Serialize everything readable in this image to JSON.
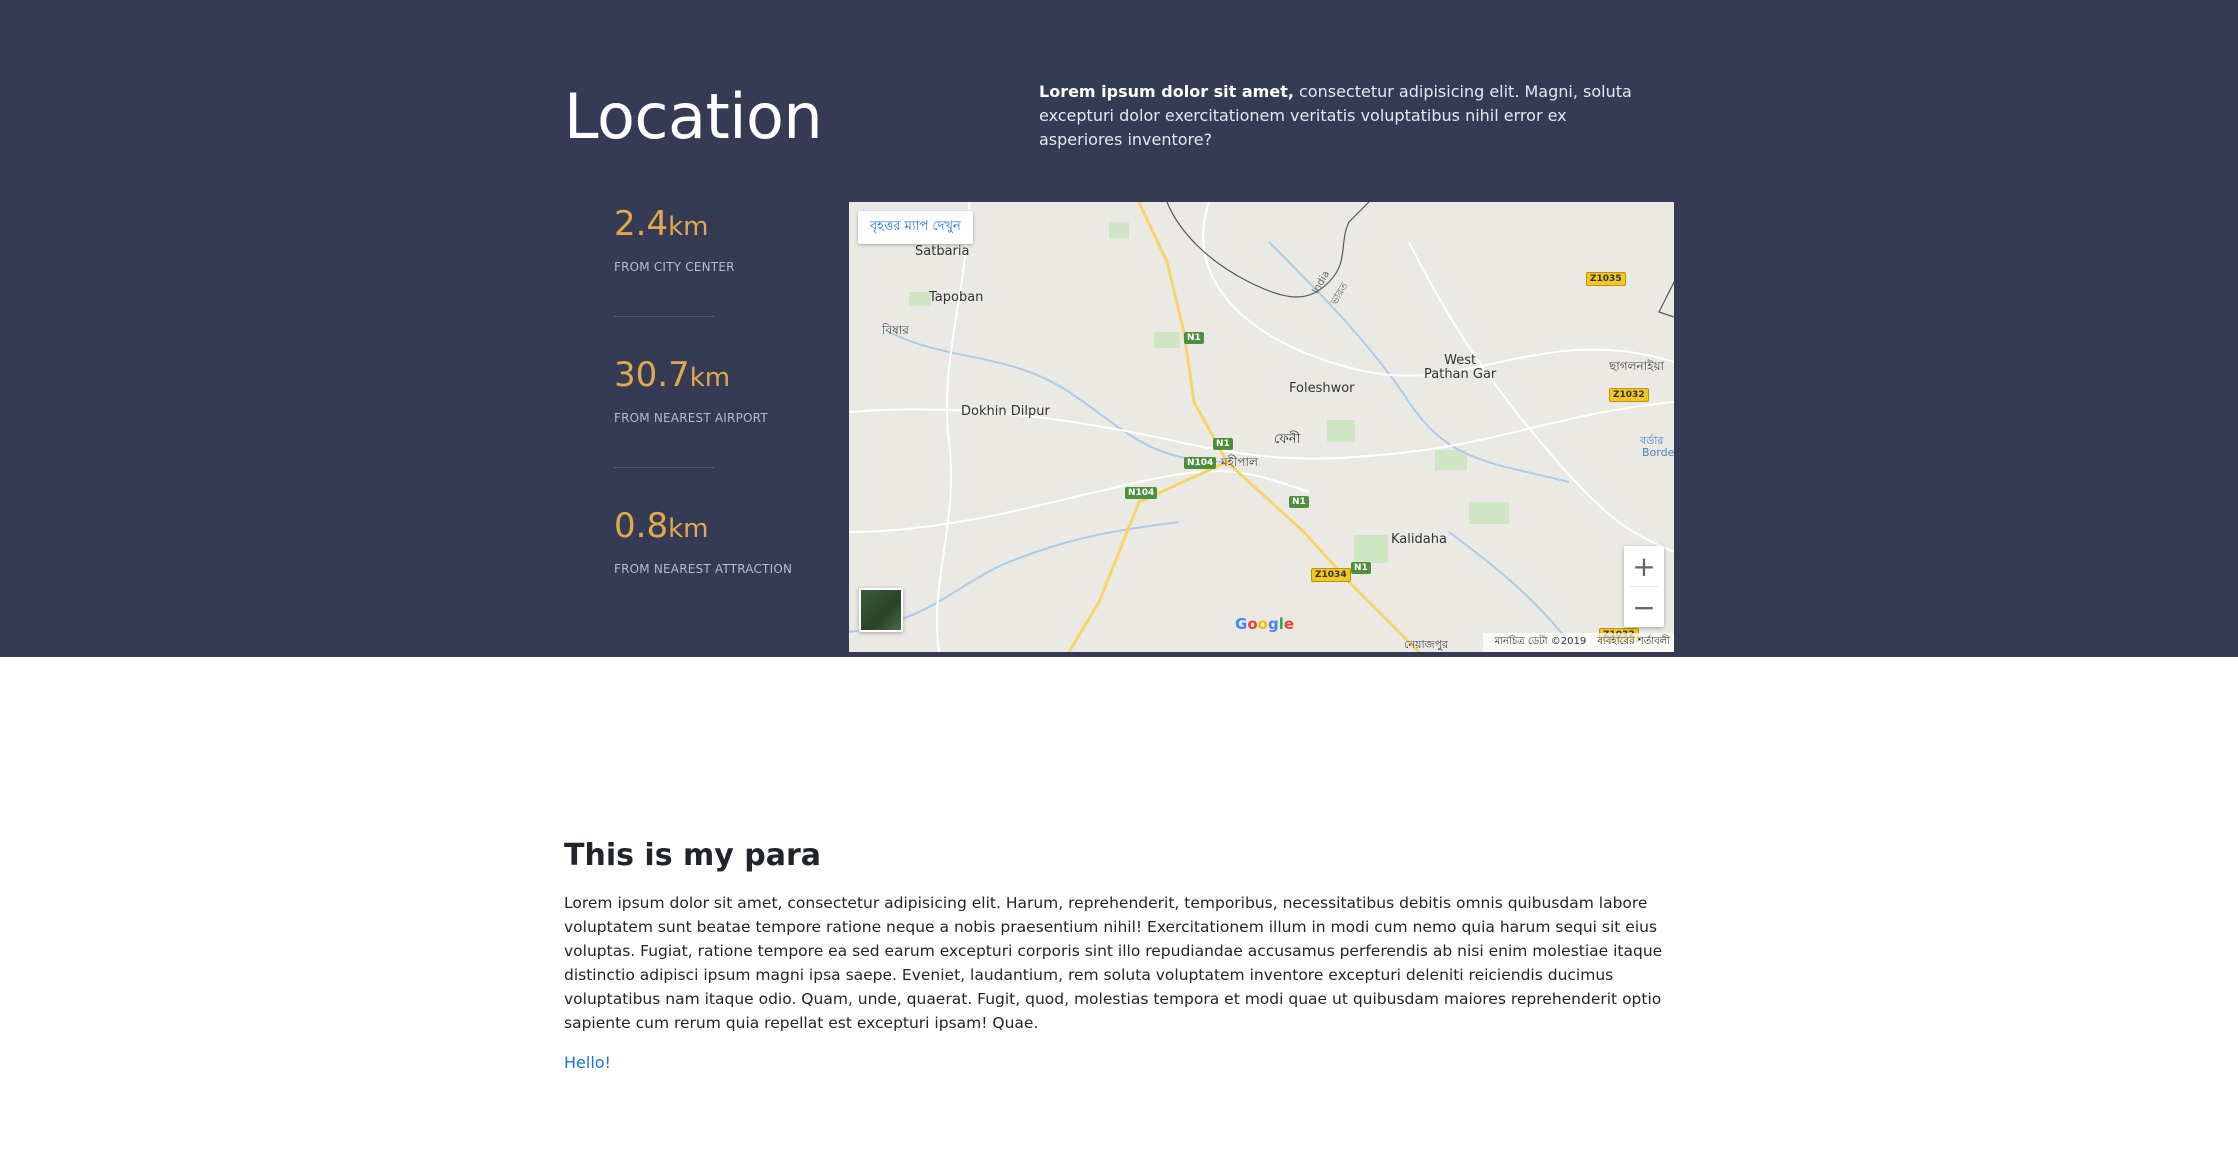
{
  "location": {
    "title": "Location",
    "intro_bold": "Lorem ipsum dolor sit amet,",
    "intro_text": " consectetur adipisicing elit. Magni, soluta excepturi dolor exercitationem veritatis voluptatibus nihil error ex asperiores inventore?"
  },
  "stats": [
    {
      "value": "2.4",
      "unit": "km",
      "label": "From city center"
    },
    {
      "value": "30.7",
      "unit": "km",
      "label": "From nearest airport"
    },
    {
      "value": "0.8",
      "unit": "km",
      "label": "From nearest attraction"
    }
  ],
  "map": {
    "view_larger_label": "বৃহত্তর ম্যাপ দেখুন",
    "places": {
      "satbaria": "Satbaria",
      "tapoban": "Tapoban",
      "bikhar": "বিষার",
      "dokhin_dilpur": "Dokhin Dilpur",
      "foleshwor": "Foleshwor",
      "west_pathan_gar": "West\nPathan Gar",
      "feni": "ফেনী",
      "mohipal": "মহীপাল",
      "kalidaha": "Kalidaha",
      "chagalnaiya": "ছাগলনাইয়া",
      "border_bn": "বর্ডার",
      "border_en": "Border",
      "india": "India",
      "bharat": "ভারত",
      "noyajpur": "নেয়াজপুর"
    },
    "roads": {
      "n1": "N1",
      "n104": "N104",
      "z1035": "Z1035",
      "z1032": "Z1032",
      "z1034": "Z1034"
    },
    "zoom_in": "+",
    "zoom_out": "−",
    "google": "Google",
    "map_data": "মানচিত্র ডেটা ©2019",
    "terms": "ব্যবহারের শর্তাবলী"
  },
  "paragraph": {
    "title": "This is my para",
    "body": "Lorem ipsum dolor sit amet, consectetur adipisicing elit. Harum, reprehenderit, temporibus, necessitatibus debitis omnis quibusdam labore voluptatem sunt beatae tempore ratione neque a nobis praesentium nihil! Exercitationem illum in modi cum nemo quia harum sequi sit eius voluptas. Fugiat, ratione tempore ea sed earum excepturi corporis sint illo repudiandae accusamus perferendis ab nisi enim molestiae itaque distinctio adipisci ipsum magni ipsa saepe. Eveniet, laudantium, rem soluta voluptatem inventore excepturi deleniti reiciendis ducimus voluptatibus nam itaque odio. Quam, unde, quaerat. Fugit, quod, molestias tempora et modi quae ut quibusdam maiores reprehenderit optio sapiente cum rerum quia repellat est excepturi ipsam! Quae.",
    "link": "Hello!"
  },
  "colors": {
    "hero_bg": "#363b55",
    "stat_accent": "#e0a84f",
    "link": "#1a73e8"
  }
}
